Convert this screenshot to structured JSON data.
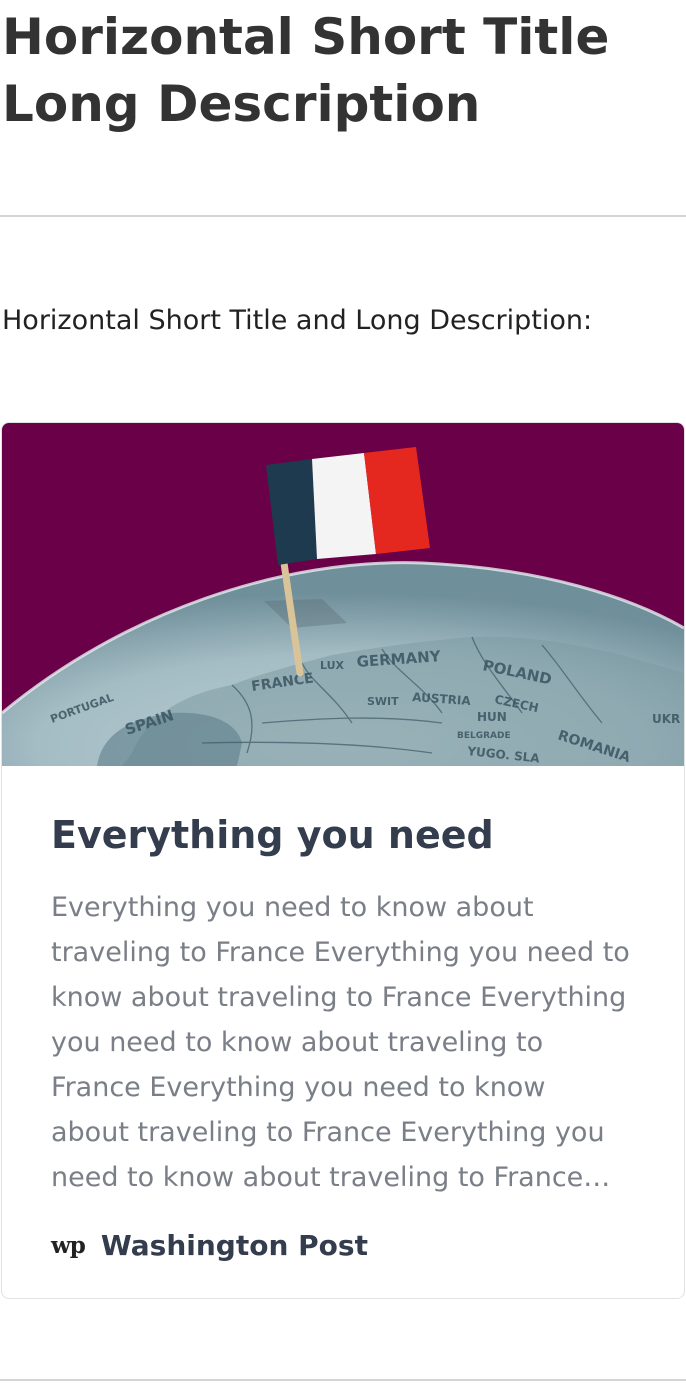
{
  "page": {
    "title": "Horizontal Short Title Long Description",
    "section_label": "Horizontal Short Title and Long Description:"
  },
  "card": {
    "title": "Everything you need",
    "description": "Everything you need to know about traveling to France Everything you need to know about traveling to France Everything you need to know about traveling to France Everything you need to know about traveling to France Everything you need to know about traveling to France Everything you need to know about traveling to France",
    "image": {
      "map_labels": [
        "GERMANY",
        "POLAND",
        "FRANCE",
        "SPAIN",
        "ROMANIA",
        "CZECH",
        "AUSTRIA",
        "HUN",
        "YUGO. SLA",
        "PORTUGAL",
        "SWIT",
        "LUX",
        "BELGRADE",
        "UKR"
      ]
    },
    "source": {
      "logo_text": "wp",
      "name": "Washington Post"
    }
  },
  "colors": {
    "image_background": "#6a0048",
    "flag_blue": "#1e3a4f",
    "flag_white": "#f4f4f4",
    "flag_red": "#e5281f",
    "title_text": "#333d4e",
    "body_text": "#7a7e87"
  }
}
